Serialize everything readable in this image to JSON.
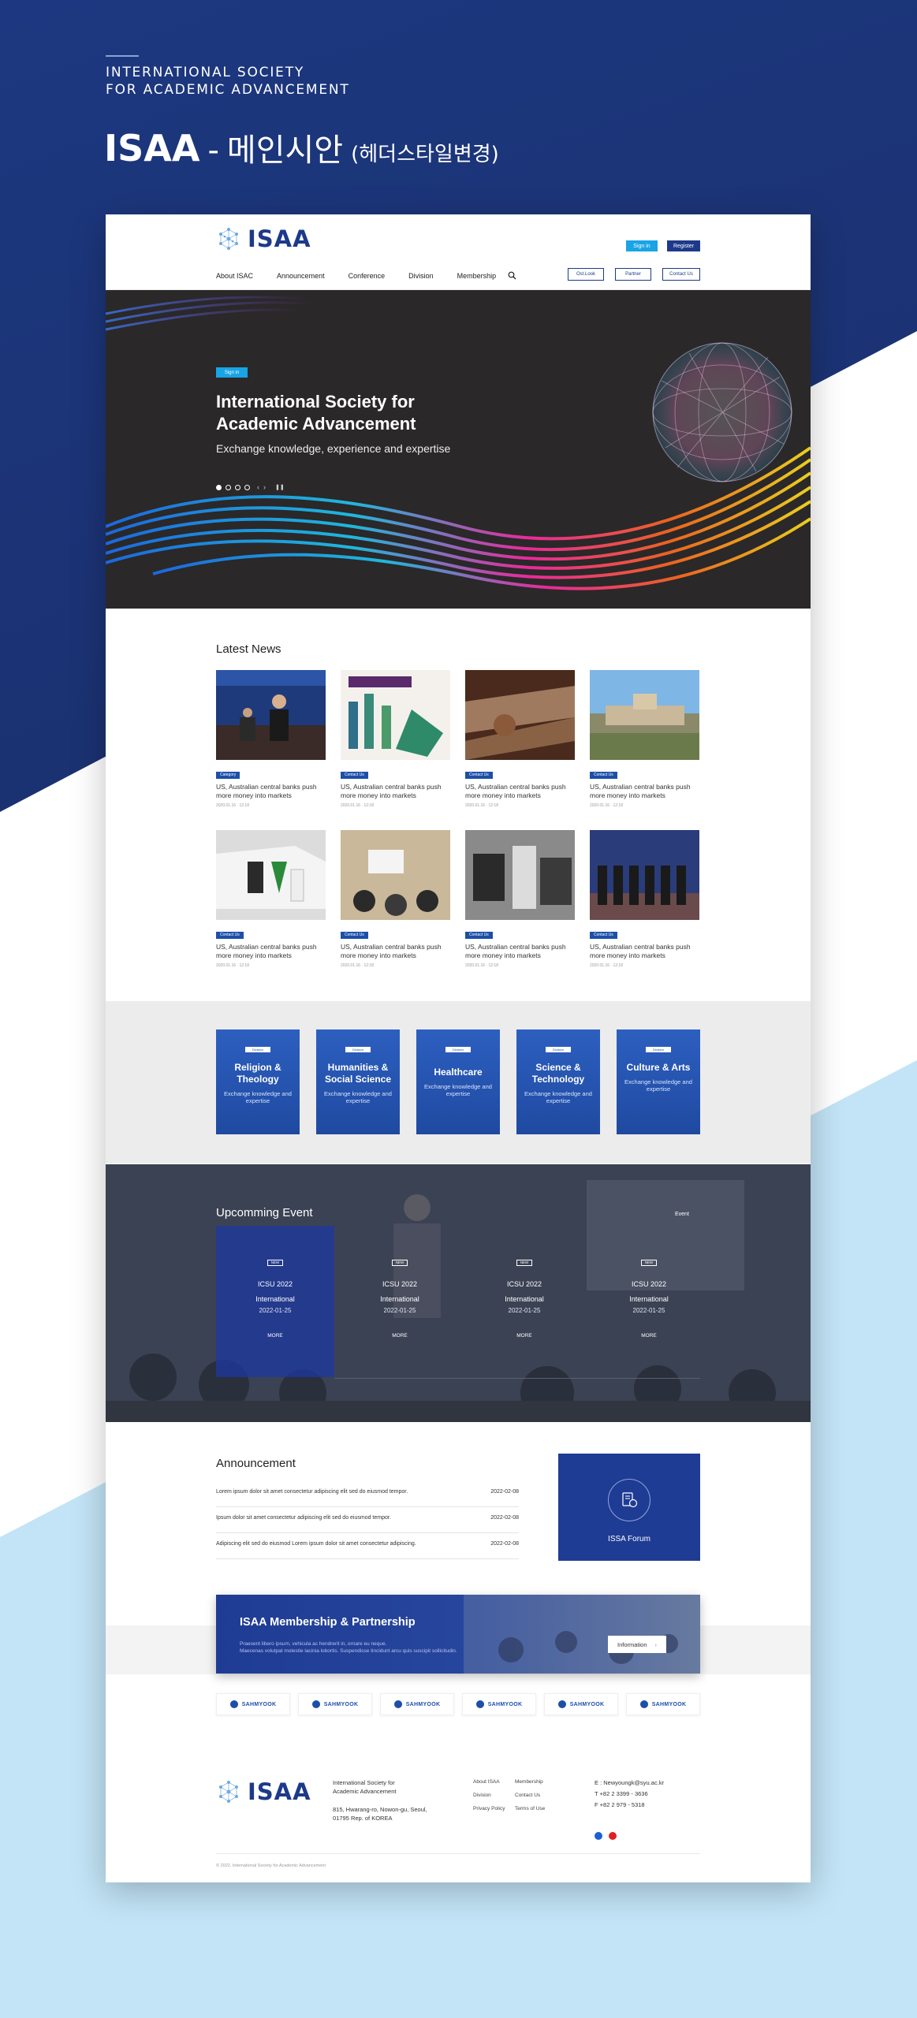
{
  "presentation": {
    "org_line1": "INTERNATIONAL SOCIETY",
    "org_line2": "FOR ACADEMIC ADVANCEMENT",
    "title_main": "ISAA",
    "title_dash": "-",
    "title_kr": "메인시안",
    "title_paren": "(헤더스타일변경)"
  },
  "header": {
    "logo_text": "ISAA",
    "signin_label": "Sign in",
    "register_label": "Register",
    "nav": [
      "About ISAC",
      "Announcement",
      "Conference",
      "Division",
      "Membership"
    ],
    "outline_buttons": [
      "Ost.Look",
      "Partner",
      "Contact Us"
    ]
  },
  "hero": {
    "pill": "Sign in",
    "title": "International Society for Academic Advancement",
    "subtitle": "Exchange knowledge, experience and expertise",
    "slide_count": 4
  },
  "news": {
    "title": "Latest News",
    "items": [
      {
        "badge": "Category",
        "title": "US, Australian central banks push more money into markets",
        "date": "2020.01.16 · 12:18"
      },
      {
        "badge": "Contact Us",
        "title": "US, Australian central banks push more money into markets",
        "date": "2020.01.16 · 12:18"
      },
      {
        "badge": "Contact Us",
        "title": "US, Australian central banks push more money into markets",
        "date": "2020.01.16 · 12:18"
      },
      {
        "badge": "Contact Us",
        "title": "US, Australian central banks push more money into markets",
        "date": "2020.01.16 · 12:18"
      },
      {
        "badge": "Contact Us",
        "title": "US, Australian central banks push more money into markets",
        "date": "2020.01.16 · 12:18"
      },
      {
        "badge": "Contact Us",
        "title": "US, Australian central banks push more money into markets",
        "date": "2020.01.16 · 12:18"
      },
      {
        "badge": "Contact Us",
        "title": "US, Australian central banks push more money into markets",
        "date": "2020.01.16 · 12:18"
      },
      {
        "badge": "Contact Us",
        "title": "US, Australian central banks push more money into markets",
        "date": "2020.01.16 · 12:18"
      }
    ]
  },
  "categories": [
    {
      "tag": "Division",
      "title": "Religion & Theology",
      "sub": "Exchange knowledge and expertise"
    },
    {
      "tag": "Division",
      "title": "Humanities & Social Science",
      "sub": "Exchange knowledge and expertise"
    },
    {
      "tag": "Division",
      "title": "Healthcare",
      "sub": "Exchange knowledge and expertise"
    },
    {
      "tag": "Division",
      "title": "Science & Technology",
      "sub": "Exchange knowledge and expertise"
    },
    {
      "tag": "Division",
      "title": "Culture & Arts",
      "sub": "Exchange knowledge and expertise"
    }
  ],
  "events": {
    "title": "Upcomming Event",
    "more": "Event",
    "items": [
      {
        "badge": "NEW",
        "name1": "ICSU 2022",
        "name2": "International",
        "date": "2022-01-25",
        "btn": "MORE"
      },
      {
        "badge": "NEW",
        "name1": "ICSU 2022",
        "name2": "International",
        "date": "2022-01-25",
        "btn": "MORE"
      },
      {
        "badge": "NEW",
        "name1": "ICSU 2022",
        "name2": "International",
        "date": "2022-01-25",
        "btn": "MORE"
      },
      {
        "badge": "NEW",
        "name1": "ICSU 2022",
        "name2": "International",
        "date": "2022-01-25",
        "btn": "MORE"
      }
    ]
  },
  "announcement": {
    "title": "Announcement",
    "rows": [
      {
        "text": "Lorem ipsum dolor sit amet consectetur adipiscing elit sed do eiusmod tempor.",
        "date": "2022-02-08"
      },
      {
        "text": "Ipsum dolor sit amet consectetur adipiscing elit sed do eiusmod tempor.",
        "date": "2022-02-08"
      },
      {
        "text": "Adipiscing elit sed do eiusmod Lorem ipsum dolor sit amet consectetur adipiscing.",
        "date": "2022-02-08"
      }
    ],
    "forum_label": "ISSA Forum"
  },
  "membership": {
    "title": "ISAA Membership & Partnership",
    "desc1": "Praesent libero ipsum, vehicula ac hendrerit in, ornare eu neque.",
    "desc2": "Maecenas volutpat molestie lacinia lobortis. Suspendisse tincidunt arcu quis suscipit sollicitudin.",
    "button": "Information"
  },
  "partners": [
    "SAHMYOOK",
    "SAHMYOOK",
    "SAHMYOOK",
    "SAHMYOOK",
    "SAHMYOOK",
    "SAHMYOOK"
  ],
  "footer": {
    "logo_text": "ISAA",
    "org1": "International Society for",
    "org2": "Academic Advancement",
    "addr1": "815, Hwarang-ro, Nowon-gu, Seoul,",
    "addr2": "01795 Rep. of KOREA",
    "links": [
      "About ISAA",
      "Membership",
      "Division",
      "Contact Us",
      "Privacy Policy",
      "Terms of Use"
    ],
    "email": "E : Newyoungk@syu.ac.kr",
    "tel": "T +82 2 3399 - 3636",
    "fax": "F +82 2 979 - 5318",
    "copyright": "© 2022. International Society for Academic Advancement"
  },
  "colors": {
    "navy": "#1d3a8a",
    "accent": "#19a4e6",
    "sky": "#c2e4f6"
  }
}
